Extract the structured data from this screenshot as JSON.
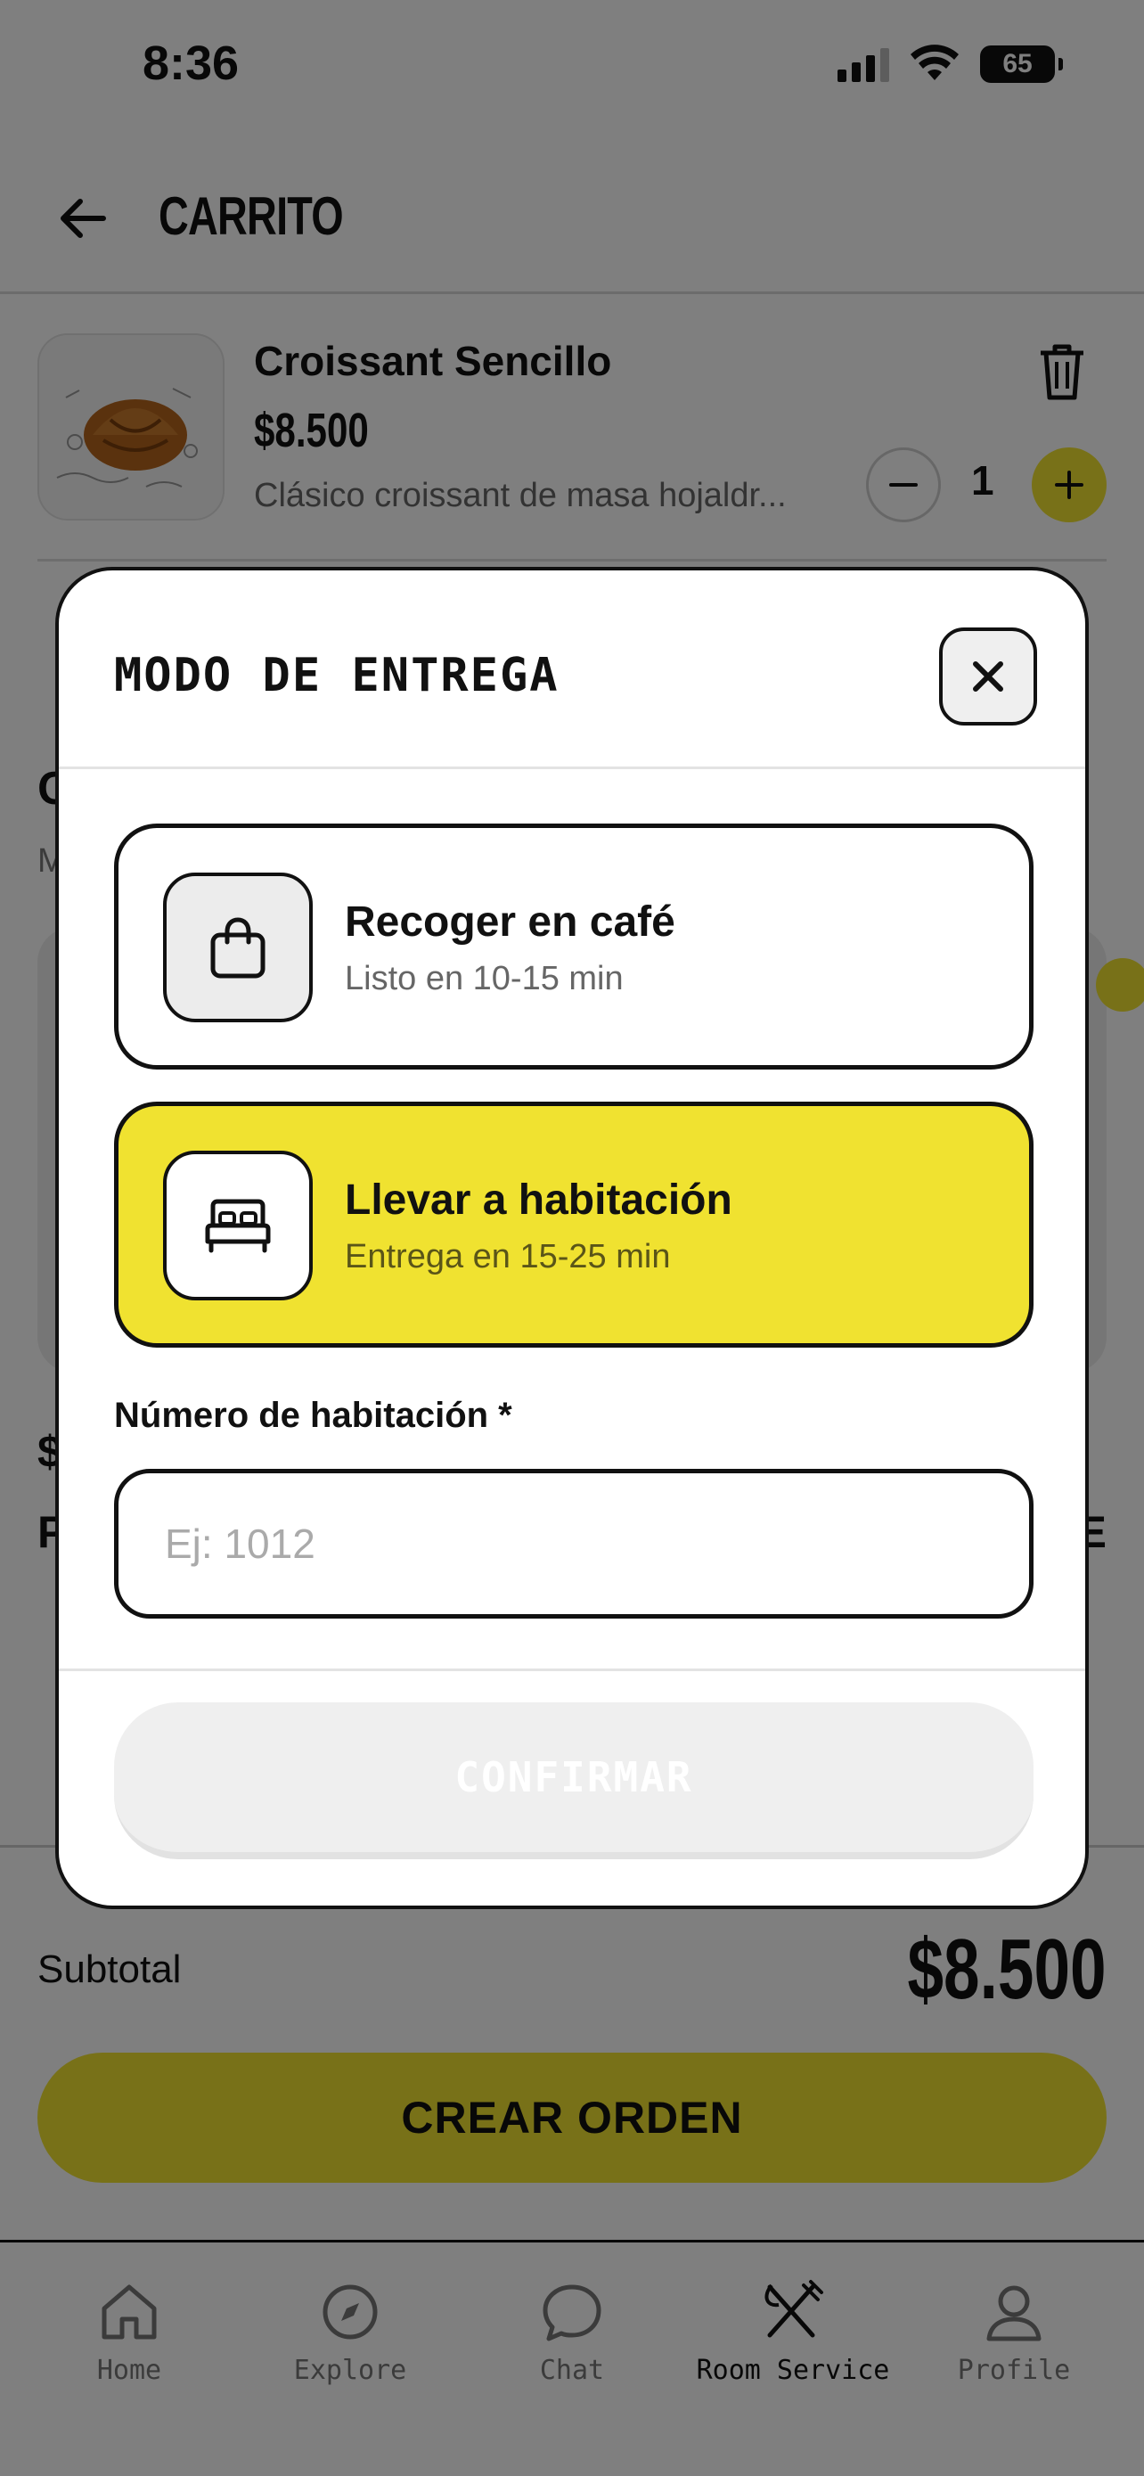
{
  "status_bar": {
    "time": "8:36",
    "battery": "65"
  },
  "header": {
    "title": "CARRITO"
  },
  "cart_item": {
    "name": "Croissant Sencillo",
    "price": "$8.500",
    "description": "Clásico croissant de masa hojaldr...",
    "quantity": "1"
  },
  "background": {
    "section_letter": "C",
    "sub_letter": "M",
    "price_letter": "$",
    "title_left_letter": "P",
    "title_right_letter": "E"
  },
  "summary": {
    "subtotal_label": "Subtotal",
    "subtotal_value": "$8.500",
    "create_order_label": "CREAR ORDEN"
  },
  "tabs": [
    {
      "label": "Home",
      "icon": "home-icon"
    },
    {
      "label": "Explore",
      "icon": "compass-icon"
    },
    {
      "label": "Chat",
      "icon": "chat-bubble-icon"
    },
    {
      "label": "Room Service",
      "icon": "fork-knife-icon",
      "active": true
    },
    {
      "label": "Profile",
      "icon": "user-icon"
    }
  ],
  "modal": {
    "title": "MODO DE ENTREGA",
    "options": [
      {
        "title": "Recoger en café",
        "subtitle": "Listo en 10-15 min",
        "icon": "shopping-bag-icon",
        "selected": false
      },
      {
        "title": "Llevar a habitación",
        "subtitle": "Entrega en 15-25 min",
        "icon": "bed-icon",
        "selected": true
      }
    ],
    "room_label": "Número de habitación *",
    "room_placeholder": "Ej: 1012",
    "room_value": "",
    "confirm_label": "CONFIRMAR"
  },
  "colors": {
    "accent_yellow": "#f0e230",
    "overlay": "rgba(0,0,0,0.5)"
  }
}
